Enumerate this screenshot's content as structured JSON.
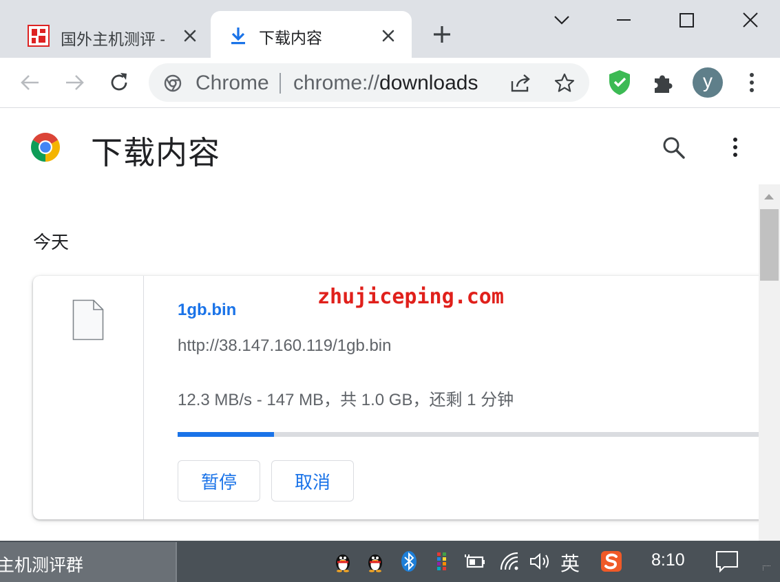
{
  "tabs": [
    {
      "title": "国外主机测评 -",
      "favicon": "red-seal-icon",
      "active": false
    },
    {
      "title": "下载内容",
      "favicon": "download-icon",
      "active": true
    }
  ],
  "toolbar": {
    "omnibox_site_label": "Chrome",
    "url_scheme": "chrome://",
    "url_path": "downloads",
    "avatar_letter": "y"
  },
  "page": {
    "title": "下载内容"
  },
  "downloads": {
    "section_date": "今天",
    "items": [
      {
        "file_name": "1gb.bin",
        "url": "http://38.147.160.119/1gb.bin",
        "status": "12.3 MB/s - 147 MB，共 1.0 GB，还剩 1 分钟",
        "progress_fraction": 0.165,
        "pause_label": "暂停",
        "cancel_label": "取消"
      }
    ]
  },
  "watermark": "zhujiceping.com",
  "taskbar": {
    "app_label": "主机测评群",
    "ime_label": "英",
    "clock": "8:10"
  },
  "colors": {
    "accent": "#1a73e8",
    "tabstrip": "#dee1e6",
    "watermark": "#e0201b",
    "taskbar": "#4a5157"
  }
}
